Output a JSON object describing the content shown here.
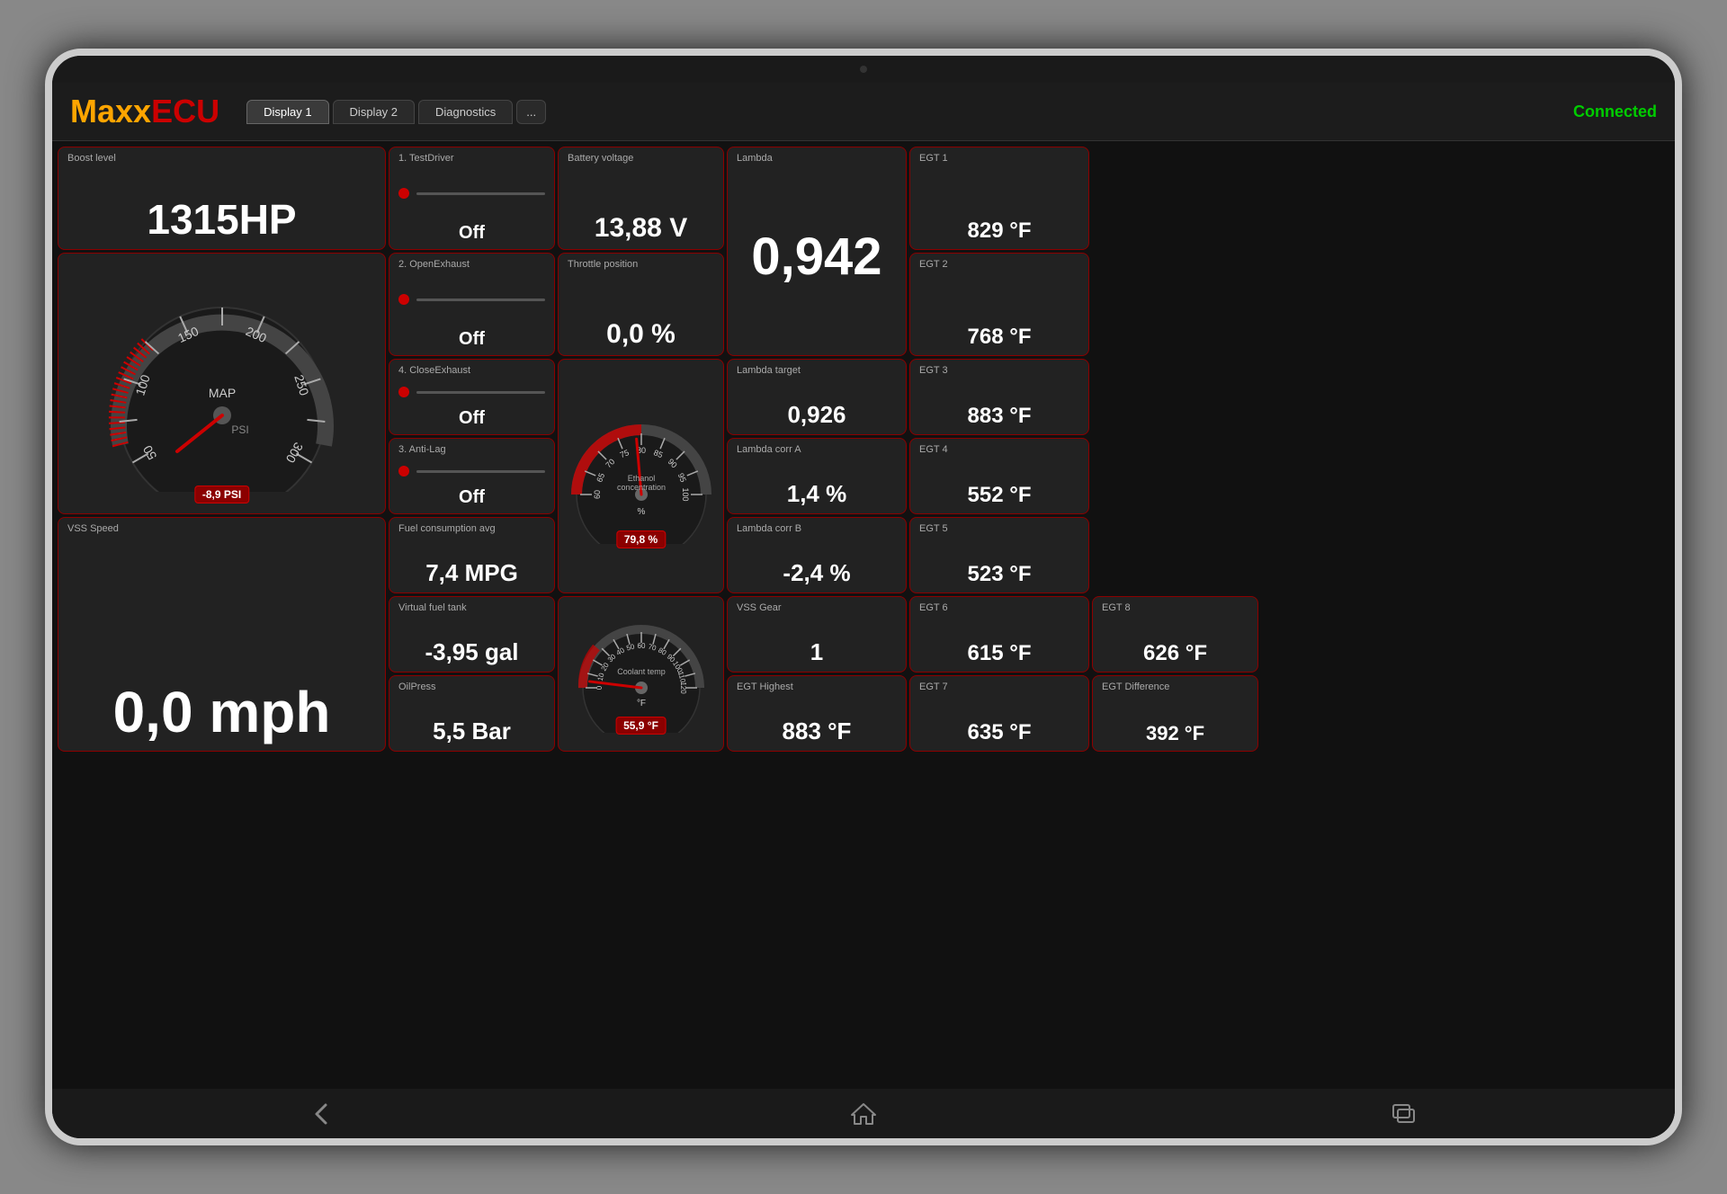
{
  "app": {
    "logo_maxx": "Maxx",
    "logo_ecu": "ECU",
    "status": "Connected"
  },
  "tabs": [
    {
      "label": "Display 1",
      "active": true
    },
    {
      "label": "Display 2",
      "active": false
    },
    {
      "label": "Diagnostics",
      "active": false
    },
    {
      "label": "...",
      "active": false
    }
  ],
  "boost": {
    "label": "Boost level",
    "value": "1315HP"
  },
  "gauge_map": {
    "label": "MAP",
    "unit": "PSI",
    "badge": "-8,9 PSI",
    "marks": [
      "50",
      "100",
      "150",
      "200",
      "250",
      "300"
    ]
  },
  "vss_speed": {
    "label": "VSS Speed",
    "value": "0,0 mph"
  },
  "testdriver": {
    "label": "1. TestDriver",
    "value": "Off"
  },
  "open_exhaust": {
    "label": "2. OpenExhaust",
    "value": "Off"
  },
  "close_exhaust": {
    "label": "4. CloseExhaust",
    "value": "Off"
  },
  "anti_lag": {
    "label": "3. Anti-Lag",
    "value": "Off"
  },
  "fuel_avg": {
    "label": "Fuel consumption avg",
    "value": "7,4 MPG"
  },
  "fuel_tank": {
    "label": "Virtual fuel tank",
    "value": "-3,95 gal"
  },
  "oil_press": {
    "label": "OilPress",
    "value": "5,5 Bar"
  },
  "battery": {
    "label": "Battery voltage",
    "value": "13,88 V"
  },
  "throttle": {
    "label": "Throttle position",
    "value": "0,0 %"
  },
  "ethanol": {
    "label": "Ethanol concentration",
    "badge": "79,8 %",
    "unit": "%",
    "marks": [
      "60",
      "65",
      "70",
      "75",
      "80",
      "85",
      "90",
      "95",
      "100"
    ]
  },
  "coolant": {
    "label": "Coolant temp",
    "badge": "55,9 °F",
    "unit": "°F",
    "marks": [
      "0",
      "10",
      "20",
      "30",
      "40",
      "50",
      "60",
      "70",
      "80",
      "90",
      "100",
      "110",
      "120"
    ]
  },
  "lambda": {
    "label": "Lambda",
    "value": "0,942"
  },
  "lambda_target": {
    "label": "Lambda target",
    "value": "0,926"
  },
  "lambda_corra": {
    "label": "Lambda corr A",
    "value": "1,4 %"
  },
  "lambda_corrb": {
    "label": "Lambda corr B",
    "value": "-2,4 %"
  },
  "vss_gear": {
    "label": "VSS Gear",
    "value": "1"
  },
  "egt_highest": {
    "label": "EGT Highest",
    "value": "883 °F"
  },
  "egt_diff": {
    "label": "EGT Difference",
    "value": "392 °F"
  },
  "egt": [
    {
      "label": "EGT 1",
      "value": "829 °F"
    },
    {
      "label": "EGT 2",
      "value": "768 °F"
    },
    {
      "label": "EGT 3",
      "value": "883 °F"
    },
    {
      "label": "EGT 4",
      "value": "552 °F"
    },
    {
      "label": "EGT 5",
      "value": "523 °F"
    },
    {
      "label": "EGT 6",
      "value": "615 °F"
    },
    {
      "label": "EGT 7",
      "value": "635 °F"
    },
    {
      "label": "EGT 8",
      "value": "626 °F"
    }
  ],
  "nav": {
    "back": "back",
    "home": "home",
    "recent": "recent"
  }
}
